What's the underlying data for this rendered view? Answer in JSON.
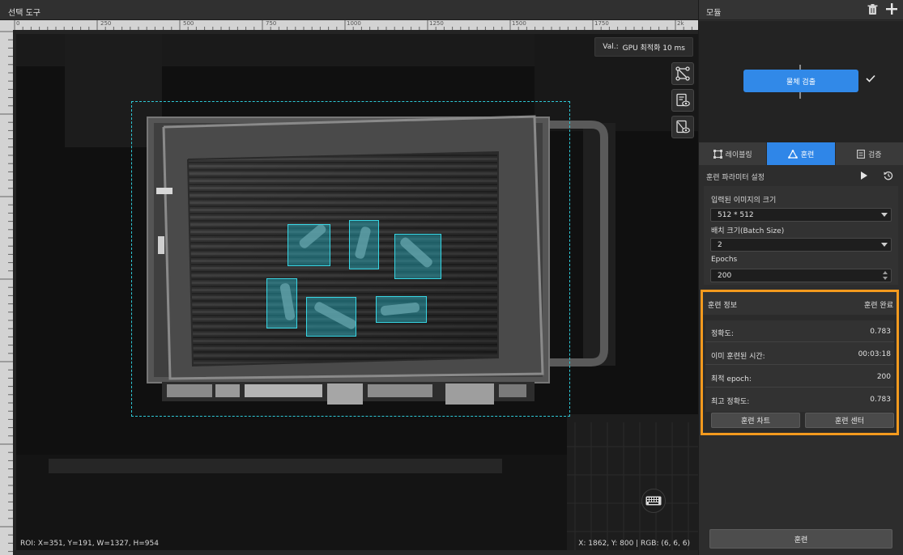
{
  "left_panel": {
    "title": "선택 도구",
    "ruler_top_labels": [
      "0",
      "250",
      "500",
      "750",
      "1000",
      "1250",
      "1500",
      "1750",
      "2k"
    ],
    "val_badge": {
      "label": "Val.:",
      "value": "GPU 최적화 10 ms"
    },
    "tools": [
      "roi-graph-icon",
      "image-eye-icon",
      "mask-eye-icon"
    ],
    "status_left": "ROI: X=351, Y=191, W=1327, H=954",
    "status_right": "X: 1862, Y: 800 | RGB: (6, 6, 6)",
    "colors": {
      "detection": "#38d6e4",
      "roi": "#2ec8d6"
    }
  },
  "right_panel": {
    "header_title": "모듈",
    "module_node": {
      "label": "물체 검출",
      "status": "check-icon"
    },
    "tabs": [
      {
        "label": "레이블링",
        "icon": "labeling-icon",
        "active": false
      },
      {
        "label": "훈련",
        "icon": "train-icon",
        "active": true
      },
      {
        "label": "검증",
        "icon": "verify-icon",
        "active": false
      }
    ],
    "section_title": "훈련 파라미터 설정",
    "params": {
      "input_size_label": "입력된 이미지의 크기",
      "input_size_value": "512 * 512",
      "batch_label": "배치 크기(Batch Size)",
      "batch_value": "2",
      "epochs_label": "Epochs",
      "epochs_value": "200"
    },
    "training_info": {
      "title": "훈련 정보",
      "status": "훈련 완료",
      "rows": [
        {
          "key": "정확도:",
          "value": "0.783"
        },
        {
          "key": "이미 훈련된 시간:",
          "value": "00:03:18"
        },
        {
          "key": "최적 epoch:",
          "value": "200"
        },
        {
          "key": "최고 정확도:",
          "value": "0.783"
        }
      ],
      "chart_button": "훈련 차트",
      "center_button": "훈련 센터",
      "highlight_color": "#f39a1e"
    },
    "train_button": "훈련",
    "accent_color": "#2f86e8"
  }
}
